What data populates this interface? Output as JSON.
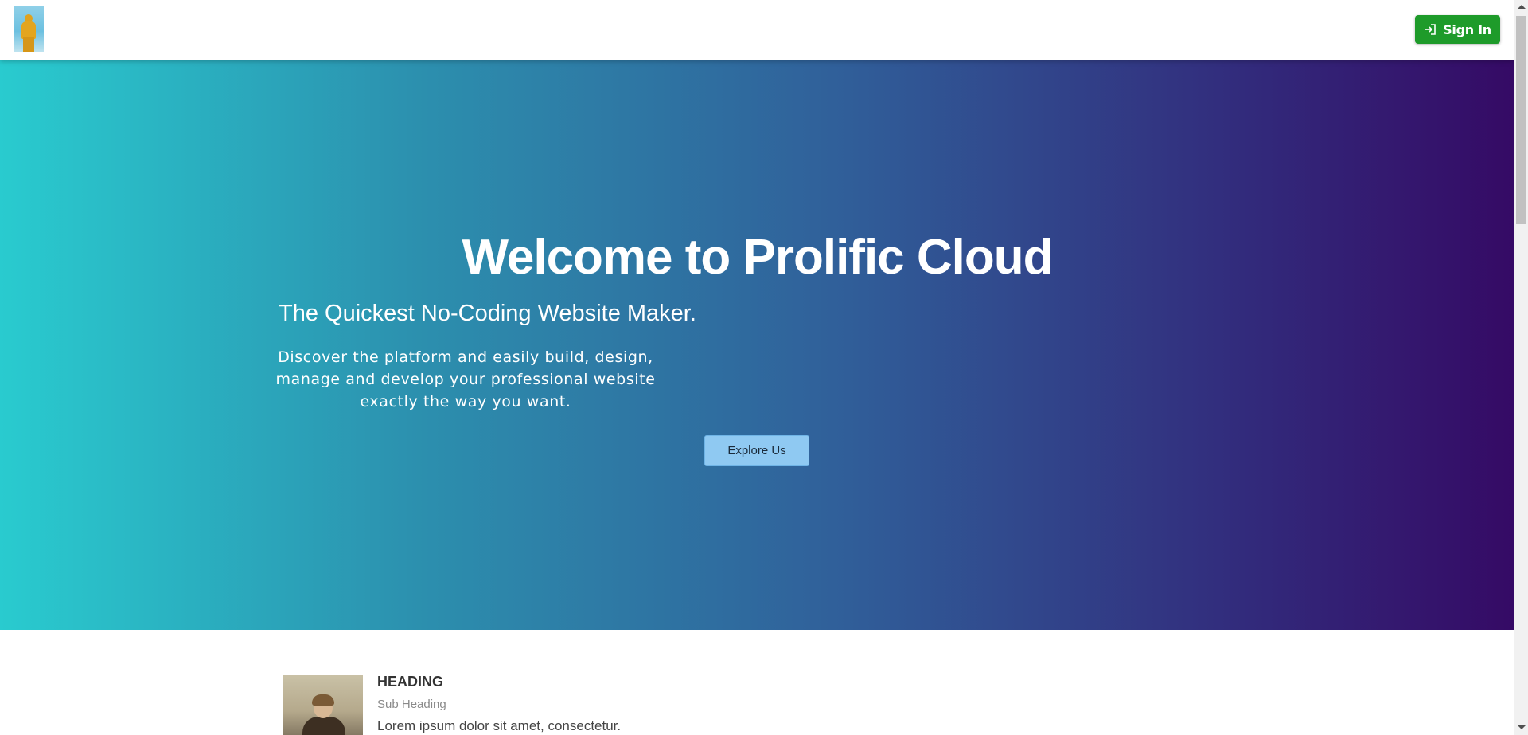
{
  "navbar": {
    "logo_alt": "logo",
    "signin_label": "Sign In",
    "signin_icon": "sign-in-icon",
    "signin_color": "#1e9b2a"
  },
  "hero": {
    "title": "Welcome to Prolific Cloud",
    "subtitle": "The Quickest No-Coding Website Maker.",
    "description": "Discover the platform and easily build, design, manage and develop your professional website exactly the way you want.",
    "cta_label": "Explore Us",
    "gradient_start": "#29cbcf",
    "gradient_end": "#350a65"
  },
  "feature": {
    "heading": "HEADING",
    "subheading": "Sub Heading",
    "text": "Lorem ipsum dolor sit amet, consectetur."
  }
}
